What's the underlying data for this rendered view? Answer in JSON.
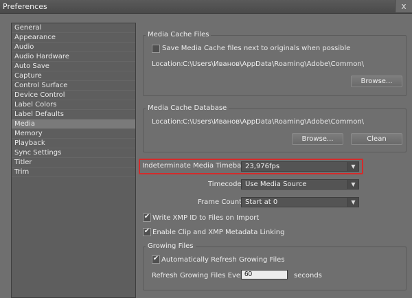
{
  "window": {
    "title": "Preferences",
    "close_glyph": "x"
  },
  "sidebar": {
    "items": [
      "General",
      "Appearance",
      "Audio",
      "Audio Hardware",
      "Auto Save",
      "Capture",
      "Control Surface",
      "Device Control",
      "Label Colors",
      "Label Defaults",
      "Media",
      "Memory",
      "Playback",
      "Sync Settings",
      "Titler",
      "Trim"
    ],
    "selected": "Media"
  },
  "media_cache_files": {
    "legend": "Media Cache Files",
    "checkbox_label": "Save Media Cache files next to originals when possible",
    "location_label": "Location:",
    "location_value": "C:\\Users\\Иванов\\AppData\\Roaming\\Adobe\\Common\\",
    "browse_label": "Browse..."
  },
  "media_cache_database": {
    "legend": "Media Cache Database",
    "location_label": "Location:",
    "location_value": "C:\\Users\\Иванов\\AppData\\Roaming\\Adobe\\Common\\",
    "browse_label": "Browse...",
    "clean_label": "Clean"
  },
  "timebase": {
    "label": "Indeterminate Media Timebase:",
    "value": "23,976fps"
  },
  "timecode": {
    "label": "Timecode:",
    "value": "Use Media Source"
  },
  "frame_count": {
    "label": "Frame Count:",
    "value": "Start at 0"
  },
  "xmp": {
    "write_label": "Write XMP ID to Files on Import",
    "link_label": "Enable Clip and XMP Metadata Linking"
  },
  "growing_files": {
    "legend": "Growing Files",
    "auto_refresh_label": "Automatically Refresh Growing Files",
    "refresh_every_label": "Refresh Growing Files Every",
    "refresh_value": "60",
    "seconds_label": "seconds"
  },
  "checkmark_glyph": "✔",
  "dropdown_arrow_glyph": "▼",
  "colors": {
    "highlight": "#d42b2b",
    "background": "#6f6f6f"
  }
}
